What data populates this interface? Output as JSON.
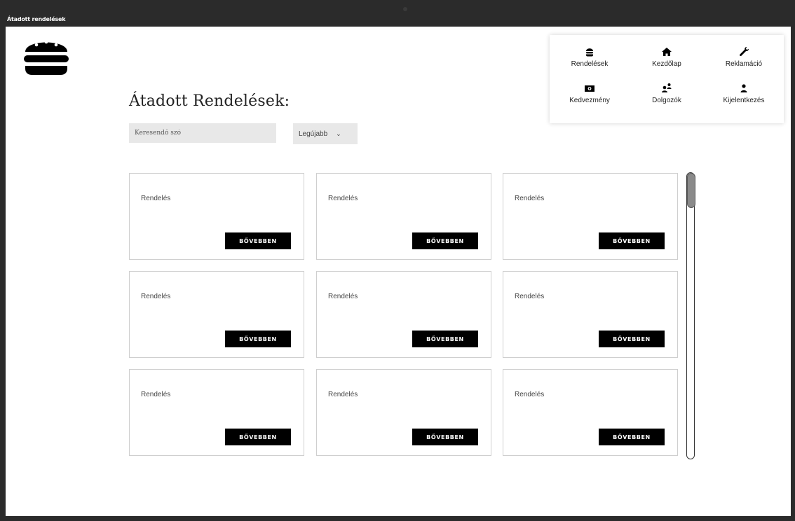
{
  "window": {
    "title": "Átadott rendelések"
  },
  "nav": {
    "items": [
      {
        "label": "Rendelések",
        "icon": "burger-icon"
      },
      {
        "label": "Kezdőlap",
        "icon": "home-icon"
      },
      {
        "label": "Reklamáció",
        "icon": "wrench-icon"
      },
      {
        "label": "Kedvezmény",
        "icon": "money-icon"
      },
      {
        "label": "Dolgozók",
        "icon": "users-icon"
      },
      {
        "label": "Kijelentkezés",
        "icon": "user-icon"
      }
    ]
  },
  "page": {
    "title": "Átadott Rendelések:",
    "search_placeholder": "Keresendő szó",
    "sort_value": "Legújabb"
  },
  "cards": [
    {
      "title": "Rendelés",
      "button": "BŐVEBBEN"
    },
    {
      "title": "Rendelés",
      "button": "BŐVEBBEN"
    },
    {
      "title": "Rendelés",
      "button": "BŐVEBBEN"
    },
    {
      "title": "Rendelés",
      "button": "BŐVEBBEN"
    },
    {
      "title": "Rendelés",
      "button": "BŐVEBBEN"
    },
    {
      "title": "Rendelés",
      "button": "BŐVEBBEN"
    },
    {
      "title": "Rendelés",
      "button": "BŐVEBBEN"
    },
    {
      "title": "Rendelés",
      "button": "BŐVEBBEN"
    },
    {
      "title": "Rendelés",
      "button": "BŐVEBBEN"
    }
  ],
  "colors": {
    "frame": "#2b2b2b",
    "button": "#000000",
    "input_bg": "#e8e8e8"
  }
}
